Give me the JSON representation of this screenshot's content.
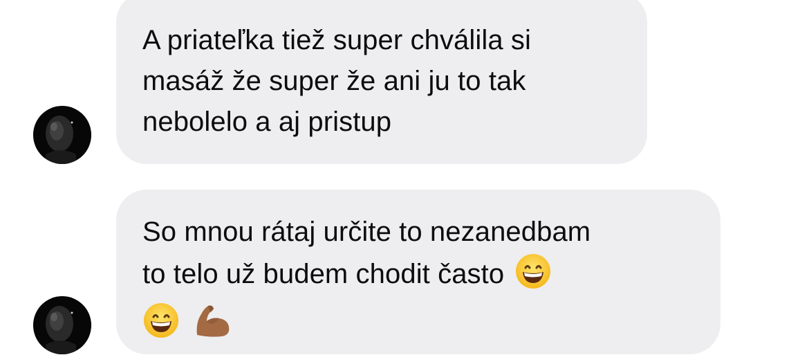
{
  "messages": [
    {
      "sender": "other",
      "avatar_icon": "avatar-photo-dark",
      "lines": [
        "A priateľka tiež super chválila si",
        "masáž že super že ani ju to tak",
        "nebolelo a aj pristup"
      ]
    },
    {
      "sender": "other",
      "avatar_icon": "avatar-photo-dark",
      "lines": [
        "So mnou rátaj určite to nezanedbam",
        "to telo už budem chodit často"
      ],
      "emojis_inline": [
        "grinning-face-emoji"
      ],
      "emojis_row": [
        "grinning-face-emoji",
        "flexed-biceps-emoji"
      ]
    }
  ],
  "colors": {
    "bubble_bg": "#eeeef0",
    "text": "#0c0c0c",
    "background": "#ffffff"
  }
}
